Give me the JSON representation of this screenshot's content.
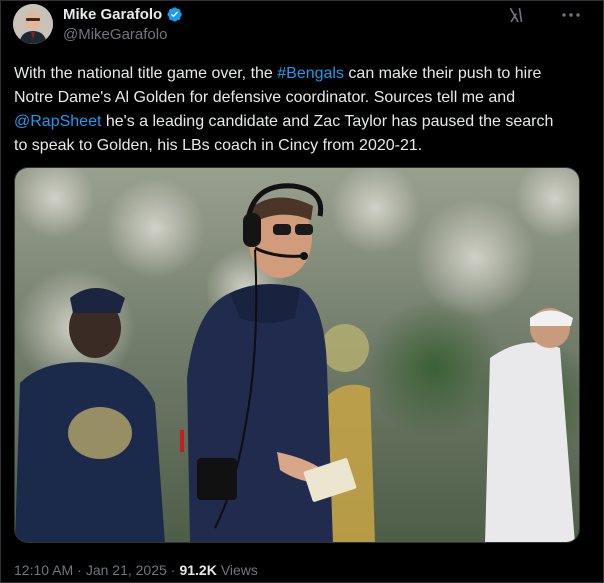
{
  "author": {
    "name": "Mike Garafolo",
    "handle": "@MikeGarafolo",
    "verified": true
  },
  "tweet": {
    "text_pre": "With the national title game over, the ",
    "hashtag": "#Bengals",
    "text_mid": " can make their push to hire\nNotre Dame's Al Golden for defensive coordinator. Sources tell me and\n",
    "mention": "@RapSheet",
    "text_post": " he's a leading candidate and Zac Taylor has paused the search\nto speak to Golden, his LBs coach in Cincy from 2020-21."
  },
  "media": {
    "alt_icons": [
      "headset-icon",
      "sunglasses-icon"
    ]
  },
  "meta": {
    "time": "12:10 AM",
    "date": "Jan 21, 2025",
    "separator": "·",
    "views_count": "91.2K",
    "views_label": "Views"
  },
  "colors": {
    "background": "#000000",
    "text": "#e7e9ea",
    "secondary": "#71767b",
    "link": "#1d9bf0",
    "border": "#2f3336"
  }
}
